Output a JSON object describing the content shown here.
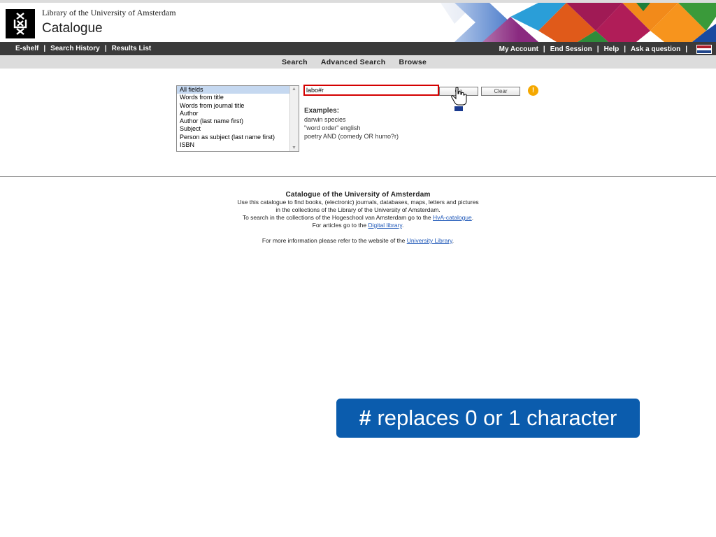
{
  "header": {
    "org": "Library of the University of Amsterdam",
    "title": "Catalogue"
  },
  "nav": {
    "left": [
      "E-shelf",
      "Search History",
      "Results List"
    ],
    "right": [
      "My Account",
      "End Session",
      "Help",
      "Ask a question"
    ],
    "separator": "|",
    "flag_colors": [
      "#ae1c28",
      "#ffffff",
      "#21468b"
    ]
  },
  "subnav": [
    "Search",
    "Advanced Search",
    "Browse"
  ],
  "search": {
    "fields": [
      "All fields",
      "Words from title",
      "Words from journal title",
      "Author",
      "Author (last name first)",
      "Subject",
      "Person as subject (last name first)",
      "ISBN"
    ],
    "selected_field": "All fields",
    "query": "labo#r",
    "go_label": "Go",
    "clear_label": "Clear",
    "info_icon": "info-icon"
  },
  "examples": {
    "title": "Examples:",
    "items": [
      "darwin species",
      "\"word order\" english",
      "poetry AND (comedy OR humo?r)"
    ]
  },
  "about": {
    "heading": "Catalogue of the University of Amsterdam",
    "line1": "Use this catalogue to find books, (electronic) journals, databases, maps, letters and pictures",
    "line2": "in the collections of the Library of the University of Amsterdam.",
    "line3_pre": "To search in the collections of the Hogeschool van Amsterdam go to the ",
    "line3_link": "HvA-catalogue",
    "line3_post": ".",
    "line4_pre": "For articles go to the ",
    "line4_link": "Digital library",
    "line4_post": ".",
    "line5_pre": "For more information please refer to the website of the ",
    "line5_link": "University Library",
    "line5_post": "."
  },
  "tip": {
    "symbol": "#",
    "text": " replaces 0 or 1 character"
  },
  "colors": {
    "accent_red": "#d40000",
    "tip_blue": "#0b5cad",
    "nav_dark": "#3a3a3a",
    "link": "#1f58b8"
  }
}
